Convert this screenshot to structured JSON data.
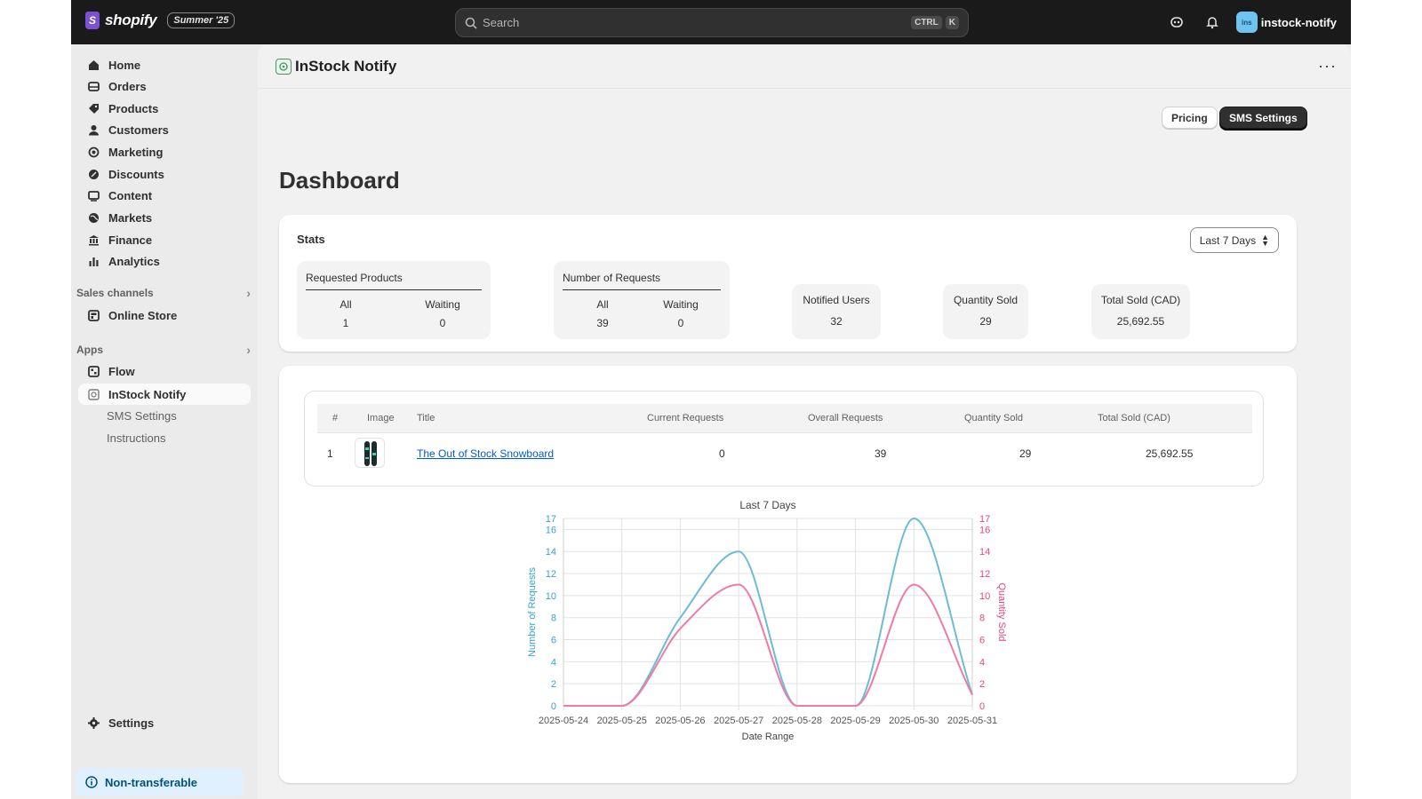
{
  "topbar": {
    "brand": "shopify",
    "brand_glyph": "S",
    "edition": "Summer '25",
    "search_placeholder": "Search",
    "shortcut_ctrl": "CTRL",
    "shortcut_k": "K",
    "store_avatar": "ins",
    "store_name": "instock-notify"
  },
  "sidebar": {
    "items": [
      {
        "label": "Home",
        "icon": "home-icon"
      },
      {
        "label": "Orders",
        "icon": "inbox-icon"
      },
      {
        "label": "Products",
        "icon": "tag-icon"
      },
      {
        "label": "Customers",
        "icon": "person-icon"
      },
      {
        "label": "Marketing",
        "icon": "target-icon"
      },
      {
        "label": "Discounts",
        "icon": "discount-icon"
      },
      {
        "label": "Content",
        "icon": "content-icon"
      },
      {
        "label": "Markets",
        "icon": "globe-icon"
      },
      {
        "label": "Finance",
        "icon": "bank-icon"
      },
      {
        "label": "Analytics",
        "icon": "bar-chart-icon"
      }
    ],
    "sales_channels_label": "Sales channels",
    "online_store": "Online Store",
    "apps_label": "Apps",
    "flow": "Flow",
    "instock_notify": "InStock Notify",
    "sub_sms": "SMS Settings",
    "sub_instructions": "Instructions",
    "settings": "Settings",
    "non_transferable": "Non-transferable"
  },
  "app": {
    "title": "InStock Notify",
    "more": "···",
    "pricing": "Pricing",
    "sms_settings": "SMS Settings"
  },
  "page_title": "Dashboard",
  "stats": {
    "title": "Stats",
    "range": "Last 7 Days",
    "requested_products": {
      "label": "Requested Products",
      "all_label": "All",
      "waiting_label": "Waiting",
      "all": "1",
      "waiting": "0"
    },
    "number_of_requests": {
      "label": "Number of Requests",
      "all_label": "All",
      "waiting_label": "Waiting",
      "all": "39",
      "waiting": "0"
    },
    "notified_users": {
      "label": "Notified Users",
      "value": "32"
    },
    "quantity_sold": {
      "label": "Quantity Sold",
      "value": "29"
    },
    "total_sold": {
      "label": "Total Sold (CAD)",
      "value": "25,692.55"
    }
  },
  "table": {
    "headers": [
      "#",
      "Image",
      "Title",
      "Current Requests",
      "Overall Requests",
      "Quantity Sold",
      "Total Sold (CAD)"
    ],
    "rows": [
      {
        "num": "1",
        "title": "The Out of Stock Snowboard",
        "current": "0",
        "overall": "39",
        "qty": "29",
        "total": "25,692.55"
      }
    ]
  },
  "chart_data": {
    "type": "line",
    "title": "Last 7 Days",
    "xlabel": "Date Range",
    "ylabel": "Number of Requests",
    "y2label": "Quantity Sold",
    "categories": [
      "2025-05-24",
      "2025-05-25",
      "2025-05-26",
      "2025-05-27",
      "2025-05-28",
      "2025-05-29",
      "2025-05-30",
      "2025-05-31"
    ],
    "series": [
      {
        "name": "Number of Requests",
        "values": [
          0,
          0,
          8,
          14,
          0,
          0,
          17,
          1
        ],
        "color": "#6bbcd4",
        "axis": "left"
      },
      {
        "name": "Quantity Sold",
        "values": [
          0,
          0,
          7,
          11,
          0,
          0,
          11,
          1
        ],
        "color": "#f07aa6",
        "axis": "right"
      }
    ],
    "ylim": [
      0,
      17
    ],
    "yticks": [
      0,
      2,
      4,
      6,
      8,
      10,
      12,
      14,
      16,
      17
    ],
    "grid": true,
    "left_axis_color": "#3aa0d0",
    "right_axis_color": "#e8457d"
  }
}
